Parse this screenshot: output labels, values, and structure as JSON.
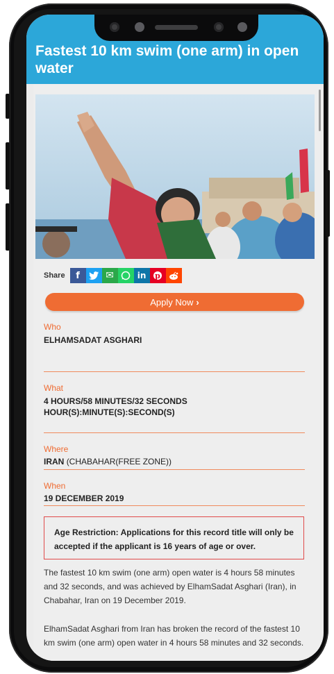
{
  "header": {
    "title": "Fastest 10 km swim (one arm) in open water"
  },
  "photo": {
    "alt_icon": "swimmer-celebrating-photo"
  },
  "share": {
    "label": "Share",
    "buttons": [
      {
        "name": "facebook",
        "glyph": "f",
        "color": "#3b5998"
      },
      {
        "name": "twitter",
        "glyph": "→",
        "color": "#1da1f2"
      },
      {
        "name": "email",
        "glyph": "✉",
        "color": "#2ba84a"
      },
      {
        "name": "whatsapp",
        "glyph": "○",
        "color": "#25d366"
      },
      {
        "name": "linkedin",
        "glyph": "in",
        "color": "#0e76a8"
      },
      {
        "name": "pinterest",
        "glyph": "P",
        "color": "#e60023"
      },
      {
        "name": "reddit",
        "glyph": "•",
        "color": "#ff4500"
      }
    ]
  },
  "apply": {
    "label": "Apply Now"
  },
  "record": {
    "who_label": "Who",
    "who_value": "ELHAMSADAT ASGHARI",
    "what_label": "What",
    "what_value_1": "4 HOURS/58 MINUTES/32 SECONDS",
    "what_value_2": "HOUR(S):MINUTE(S):SECOND(S)",
    "where_label": "Where",
    "where_country": "IRAN",
    "where_place": "(CHABAHAR(FREE ZONE))",
    "when_label": "When",
    "when_value": "19 DECEMBER 2019"
  },
  "age_restriction": "Age Restriction: Applications for this record title will only be accepted if the applicant is 16 years of age or over.",
  "description": {
    "para1": "The fastest 10 km swim (one arm) open water is 4 hours 58 minutes and 32 seconds, and was achieved by ElhamSadat Asghari (Iran), in Chabahar, Iran on 19 December 2019.",
    "para2": "ElhamSadat Asghari from Iran has broken the record of the fastest 10 km swim (one arm) open water in 4 hours 58 minutes and 32 seconds."
  },
  "colors": {
    "header": "#2ca7d9",
    "accent": "#ef6c33",
    "alert_border": "#e04a4a"
  }
}
